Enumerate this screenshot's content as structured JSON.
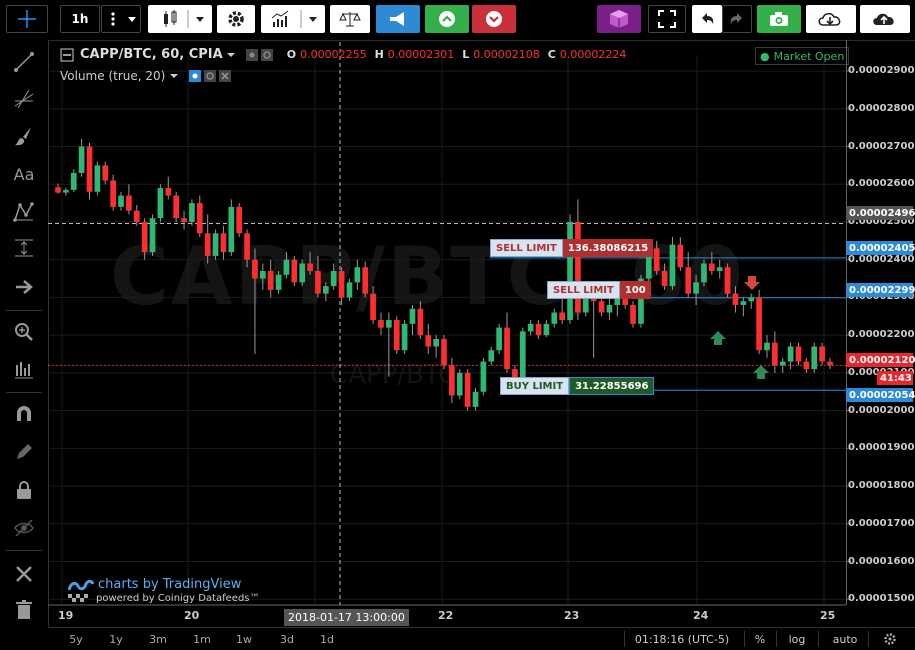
{
  "toolbar": {
    "interval": "1h",
    "items": [
      "crosshair",
      "interval",
      "bar-style",
      "settings",
      "indicators",
      "compare",
      "broadcast",
      "buy",
      "sell",
      "cube",
      "fullscreen",
      "undo",
      "redo",
      "snapshot",
      "cloud-download",
      "cloud-upload"
    ]
  },
  "legend": {
    "symbol": "CAPP/BTC, 60, CPIA",
    "o_label": "O",
    "o_value": "0.00002255",
    "h_label": "H",
    "h_value": "0.00002301",
    "l_label": "L",
    "l_value": "0.00002108",
    "c_label": "C",
    "c_value": "0.00002224",
    "volume": "Volume (true, 20)"
  },
  "market_status": "Market Open",
  "watermark": "CAPP/BTC, 60",
  "watermark_sub": "CAPP/BTC",
  "orders": [
    {
      "type": "SELL LIMIT",
      "value": "136.38086215",
      "price_label": "0.00002405"
    },
    {
      "type": "SELL LIMIT",
      "value": "100",
      "price_label": "0.00002299"
    },
    {
      "type": "BUY LIMIT",
      "value": "31.22855696",
      "price_label": "0.00002054"
    }
  ],
  "crosshair": {
    "price": "0.00002496",
    "time": "2018-01-17 13:00:00"
  },
  "last_price": {
    "price": "0.00002120",
    "countdown": "41:43"
  },
  "branding": {
    "line1": "charts by TradingView",
    "line2": "powered by Coinigy Datafeeds™"
  },
  "bottom": {
    "ranges": [
      "5y",
      "1y",
      "3m",
      "1m",
      "1w",
      "3d",
      "1d"
    ],
    "time": "01:18:16 (UTC-5)",
    "percent": "%",
    "log": "log",
    "auto": "auto"
  },
  "colors": {
    "up": "#2fb872",
    "down": "#ff2e2e",
    "accent": "#2196f3",
    "grid": "#1c1c1c"
  },
  "chart_data": {
    "type": "candlestick",
    "x_ticks": [
      "19",
      "20",
      "21",
      "22",
      "23",
      "24",
      "25"
    ],
    "y_ticks": [
      "0.00002900",
      "0.00002800",
      "0.00002700",
      "0.00002600",
      "0.00002500",
      "0.00002400",
      "0.00002300",
      "0.00002200",
      "0.00002100",
      "0.00002000",
      "0.00001900",
      "0.00001800",
      "0.00001700",
      "0.00001600",
      "0.00001500"
    ],
    "ylim": [
      1.49e-05,
      2.94e-05
    ],
    "candles": [
      [
        2592,
        2602,
        2575,
        2578
      ],
      [
        2578,
        2590,
        2570,
        2585
      ],
      [
        2585,
        2640,
        2580,
        2630
      ],
      [
        2630,
        2720,
        2620,
        2700
      ],
      [
        2700,
        2710,
        2560,
        2580
      ],
      [
        2580,
        2660,
        2570,
        2650
      ],
      [
        2650,
        2660,
        2600,
        2610
      ],
      [
        2610,
        2625,
        2530,
        2540
      ],
      [
        2540,
        2580,
        2530,
        2570
      ],
      [
        2570,
        2600,
        2520,
        2530
      ],
      [
        2530,
        2545,
        2490,
        2500
      ],
      [
        2500,
        2510,
        2400,
        2420
      ],
      [
        2420,
        2520,
        2410,
        2510
      ],
      [
        2510,
        2600,
        2500,
        2590
      ],
      [
        2590,
        2620,
        2560,
        2570
      ],
      [
        2570,
        2580,
        2500,
        2510
      ],
      [
        2510,
        2530,
        2480,
        2500
      ],
      [
        2500,
        2560,
        2490,
        2550
      ],
      [
        2550,
        2570,
        2460,
        2470
      ],
      [
        2470,
        2520,
        2390,
        2410
      ],
      [
        2410,
        2480,
        2400,
        2470
      ],
      [
        2470,
        2490,
        2400,
        2420
      ],
      [
        2420,
        2560,
        2410,
        2540
      ],
      [
        2540,
        2550,
        2460,
        2470
      ],
      [
        2470,
        2480,
        2380,
        2400
      ],
      [
        2400,
        2430,
        2150,
        2350
      ],
      [
        2350,
        2390,
        2320,
        2370
      ],
      [
        2370,
        2400,
        2300,
        2320
      ],
      [
        2320,
        2370,
        2310,
        2360
      ],
      [
        2360,
        2420,
        2350,
        2400
      ],
      [
        2400,
        2410,
        2330,
        2340
      ],
      [
        2340,
        2400,
        2330,
        2390
      ],
      [
        2390,
        2420,
        2360,
        2370
      ],
      [
        2370,
        2410,
        2300,
        2310
      ],
      [
        2310,
        2340,
        2290,
        2330
      ],
      [
        2330,
        2390,
        2320,
        2370
      ],
      [
        2370,
        2380,
        2280,
        2300
      ],
      [
        2300,
        2350,
        2290,
        2340
      ],
      [
        2340,
        2400,
        2320,
        2380
      ],
      [
        2380,
        2395,
        2300,
        2310
      ],
      [
        2310,
        2330,
        2230,
        2240
      ],
      [
        2240,
        2260,
        2200,
        2220
      ],
      [
        2220,
        2260,
        2090,
        2240
      ],
      [
        2240,
        2250,
        2150,
        2160
      ],
      [
        2160,
        2240,
        2150,
        2230
      ],
      [
        2230,
        2280,
        2200,
        2270
      ],
      [
        2270,
        2290,
        2190,
        2200
      ],
      [
        2200,
        2230,
        2150,
        2170
      ],
      [
        2170,
        2200,
        2140,
        2190
      ],
      [
        2190,
        2200,
        2110,
        2120
      ],
      [
        2120,
        2140,
        2020,
        2040
      ],
      [
        2040,
        2110,
        2030,
        2100
      ],
      [
        2100,
        2110,
        2000,
        2010
      ],
      [
        2010,
        2060,
        2000,
        2050
      ],
      [
        2050,
        2140,
        2040,
        2130
      ],
      [
        2130,
        2170,
        2120,
        2160
      ],
      [
        2160,
        2230,
        2150,
        2220
      ],
      [
        2220,
        2260,
        2100,
        2110
      ],
      [
        2110,
        2120,
        2050,
        2060
      ],
      [
        2060,
        2220,
        2050,
        2210
      ],
      [
        2210,
        2240,
        2200,
        2230
      ],
      [
        2230,
        2240,
        2190,
        2200
      ],
      [
        2200,
        2240,
        2195,
        2230
      ],
      [
        2230,
        2270,
        2220,
        2260
      ],
      [
        2260,
        2330,
        2230,
        2240
      ],
      [
        2240,
        2520,
        2230,
        2500
      ],
      [
        2500,
        2560,
        2240,
        2260
      ],
      [
        2260,
        2320,
        2250,
        2310
      ],
      [
        2310,
        2330,
        2140,
        2290
      ],
      [
        2290,
        2310,
        2250,
        2260
      ],
      [
        2260,
        2300,
        2240,
        2280
      ],
      [
        2280,
        2310,
        2250,
        2300
      ],
      [
        2300,
        2320,
        2270,
        2280
      ],
      [
        2280,
        2290,
        2220,
        2230
      ],
      [
        2230,
        2360,
        2220,
        2350
      ],
      [
        2350,
        2450,
        2340,
        2430
      ],
      [
        2430,
        2450,
        2360,
        2370
      ],
      [
        2370,
        2390,
        2320,
        2330
      ],
      [
        2330,
        2460,
        2320,
        2440
      ],
      [
        2440,
        2460,
        2370,
        2380
      ],
      [
        2380,
        2420,
        2300,
        2310
      ],
      [
        2310,
        2360,
        2280,
        2340
      ],
      [
        2340,
        2400,
        2330,
        2390
      ],
      [
        2390,
        2420,
        2360,
        2370
      ],
      [
        2370,
        2400,
        2350,
        2380
      ],
      [
        2380,
        2390,
        2300,
        2310
      ],
      [
        2310,
        2330,
        2260,
        2280
      ],
      [
        2280,
        2300,
        2250,
        2290
      ],
      [
        2290,
        2310,
        2270,
        2300
      ],
      [
        2300,
        2320,
        2150,
        2160
      ],
      [
        2160,
        2200,
        2140,
        2180
      ],
      [
        2180,
        2210,
        2100,
        2120
      ],
      [
        2120,
        2140,
        2100,
        2130
      ],
      [
        2130,
        2180,
        2110,
        2170
      ],
      [
        2170,
        2180,
        2120,
        2130
      ],
      [
        2130,
        2140,
        2100,
        2110
      ],
      [
        2110,
        2180,
        2100,
        2170
      ],
      [
        2170,
        2180,
        2120,
        2130
      ],
      [
        2130,
        2140,
        2110,
        2120
      ]
    ]
  }
}
